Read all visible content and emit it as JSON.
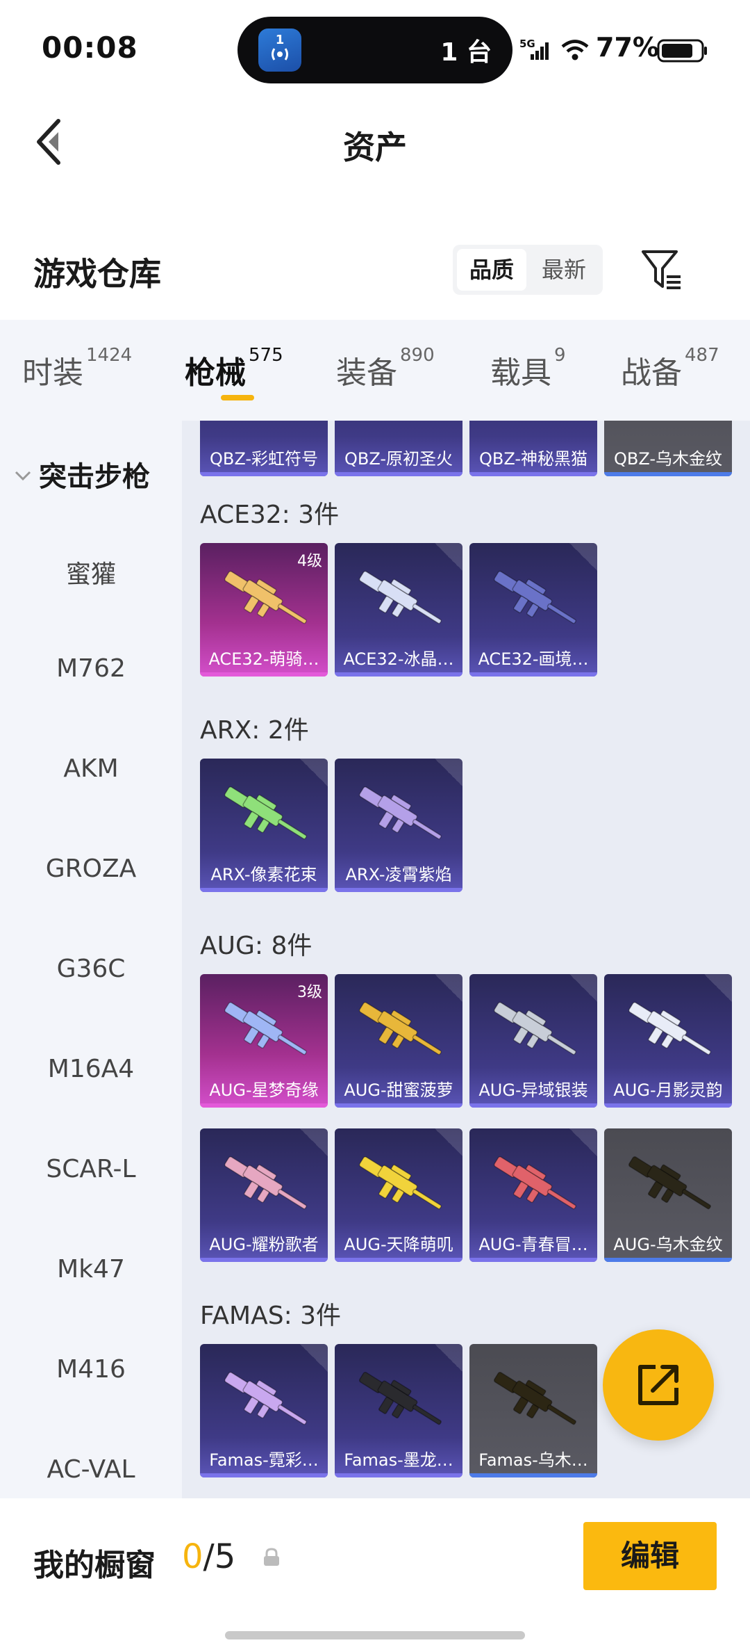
{
  "status_bar": {
    "time": "00:08",
    "island_app_badge": "1",
    "island_text": "1 台",
    "network": "5G",
    "battery_percent": "77%"
  },
  "nav": {
    "title": "资产",
    "back_icon": "back-arrow-icon"
  },
  "warehouse": {
    "title": "游戏仓库",
    "sort_options": [
      "品质",
      "最新"
    ],
    "active_sort": "品质",
    "filter_icon": "filter-icon"
  },
  "tabs": [
    {
      "label": "时装",
      "count": "1424"
    },
    {
      "label": "枪械",
      "count": "575"
    },
    {
      "label": "装备",
      "count": "890"
    },
    {
      "label": "载具",
      "count": "9"
    },
    {
      "label": "战备",
      "count": "487"
    }
  ],
  "active_tab": "枪械",
  "sidebar": {
    "header": "突击步枪",
    "items": [
      "蜜獾",
      "M762",
      "AKM",
      "GROZA",
      "G36C",
      "M16A4",
      "SCAR-L",
      "Mk47",
      "M416",
      "AC-VAL"
    ]
  },
  "sections": [
    {
      "title": "",
      "items": [
        {
          "name": "QBZ-彩虹符号",
          "rarity": "purple"
        },
        {
          "name": "QBZ-原初圣火",
          "rarity": "purple"
        },
        {
          "name": "QBZ-神秘黑猫",
          "rarity": "purple"
        },
        {
          "name": "QBZ-乌木金纹",
          "rarity": "gray"
        }
      ]
    },
    {
      "title": "ACE32: 3件",
      "items": [
        {
          "name": "ACE32-萌骑…",
          "rarity": "gold",
          "level": "4级",
          "color": "#f0c16a"
        },
        {
          "name": "ACE32-冰晶…",
          "rarity": "purple",
          "color": "#d8dff5"
        },
        {
          "name": "ACE32-画境…",
          "rarity": "purple",
          "color": "#6a72c8"
        }
      ]
    },
    {
      "title": "ARX: 2件",
      "items": [
        {
          "name": "ARX-像素花束",
          "rarity": "purple",
          "color": "#8fe07a"
        },
        {
          "name": "ARX-凌霄紫焰",
          "rarity": "purple",
          "color": "#b4a0e8"
        }
      ]
    },
    {
      "title": "AUG: 8件",
      "items": [
        {
          "name": "AUG-星梦奇缘",
          "rarity": "gold",
          "level": "3级",
          "color": "#9fb6f5"
        },
        {
          "name": "AUG-甜蜜菠萝",
          "rarity": "purple",
          "color": "#e8b73a"
        },
        {
          "name": "AUG-异域银装",
          "rarity": "purple",
          "color": "#c8ced8"
        },
        {
          "name": "AUG-月影灵韵",
          "rarity": "purple",
          "color": "#e8ecf7"
        },
        {
          "name": "AUG-耀粉歌者",
          "rarity": "purple",
          "color": "#e6a7c1"
        },
        {
          "name": "AUG-天降萌叽",
          "rarity": "purple",
          "color": "#f1d33b"
        },
        {
          "name": "AUG-青春冒…",
          "rarity": "purple",
          "color": "#e0626a"
        },
        {
          "name": "AUG-乌木金纹",
          "rarity": "gray",
          "color": "#2a2618"
        }
      ]
    },
    {
      "title": "FAMAS: 3件",
      "items": [
        {
          "name": "Famas-霓彩…",
          "rarity": "purple",
          "color": "#c9a8ef"
        },
        {
          "name": "Famas-墨龙…",
          "rarity": "purple",
          "color": "#2a2a2e"
        },
        {
          "name": "Famas-乌木…",
          "rarity": "gray",
          "color": "#2c2614"
        }
      ]
    }
  ],
  "fab": {
    "icon": "share-icon"
  },
  "bottom": {
    "showcase_label": "我的橱窗",
    "showcase_current": "0",
    "showcase_total": "/5",
    "edit_label": "编辑"
  }
}
